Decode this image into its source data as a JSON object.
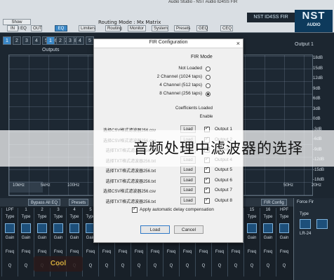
{
  "window": {
    "title": "Audio Studio - NST Audio ID4SS FIR",
    "brand": "NST ID4SS FIR",
    "logo_big": "NST",
    "logo_small": "AUDIO"
  },
  "toolbar": {
    "row1_label": "Routing Mode : Mx Matrix",
    "show_global_eq": "Show Global EQ",
    "buttons": [
      "IN",
      "OUT",
      "EQ",
      "Limiters",
      "Routing",
      "Monitor",
      "System",
      "Presets",
      "GEQ",
      "CEQ"
    ]
  },
  "channels": [
    "1",
    "2",
    "3",
    "4",
    "5",
    "6",
    "7",
    "8"
  ],
  "channels_right": [
    "1",
    "2",
    "3",
    "4",
    "5"
  ],
  "graph": {
    "outputs_label": "Outputs",
    "output1_label": "Output 1",
    "y_ticks": [
      "18dB",
      "15dB",
      "12dB",
      "9dB",
      "6dB",
      "3dB",
      "0dB",
      "-3dB",
      "-6dB",
      "-9dB",
      "-12dB",
      "-15dB",
      "-18dB"
    ],
    "x_ticks": [
      "10kHz",
      "5kHz",
      "100Hz",
      "50Hz",
      "20Hz"
    ]
  },
  "bottom": {
    "tabs": [
      "Bypass All EQ",
      "Presets",
      "FIR Config",
      "Force Fir"
    ],
    "strip_labels": [
      "LPF",
      "1",
      "2",
      "3",
      "4",
      "5",
      "6",
      "7",
      "8",
      "9",
      "10",
      "11",
      "12",
      "13",
      "14",
      "15",
      "16",
      "HPF"
    ],
    "strip_type": "Type",
    "strip_freq": "Freq",
    "strip_q": "Q",
    "strip_gain": "Gain",
    "right_type": "Type",
    "right_value": "LR-24",
    "watermark": "Cool"
  },
  "dialog": {
    "title": "FIR Configuration",
    "close": "×",
    "fir_mode_title": "FIR Mode",
    "modes": [
      {
        "label": "Not Loaded",
        "selected": false
      },
      {
        "label": "2 Channel (1024 taps)",
        "selected": false
      },
      {
        "label": "4 Channel (512 taps)",
        "selected": false
      },
      {
        "label": "8 Channel (256 taps)",
        "selected": true
      }
    ],
    "col_coeff": "Coefficients Loaded",
    "col_enable": "Enable",
    "outputs": [
      {
        "file": "选择CSV格式滤波器256.csv",
        "load": "Load",
        "enabled": true,
        "name": "Output 1"
      },
      {
        "file": "选择CSV格式滤波器256.csv",
        "load": "Load",
        "enabled": true,
        "name": "Output 2"
      },
      {
        "file": "选择TXT格式滤波器256.txt",
        "load": "Load",
        "enabled": true,
        "name": "Output 3"
      },
      {
        "file": "选择TXT格式滤波器256.txt",
        "load": "Load",
        "enabled": true,
        "name": "Output 4"
      },
      {
        "file": "选择TXT格式滤波器256.txt",
        "load": "Load",
        "enabled": true,
        "name": "Output 5"
      },
      {
        "file": "选择TXT格式滤波器256.txt",
        "load": "Load",
        "enabled": true,
        "name": "Output 6"
      },
      {
        "file": "选择CSV格式滤波器256.csv",
        "load": "Load",
        "enabled": true,
        "name": "Output 7"
      },
      {
        "file": "选择TXT格式滤波器256.txt",
        "load": "Load",
        "enabled": true,
        "name": "Output 8"
      }
    ],
    "apply_label": "Apply automatic delay compensation",
    "apply_checked": true,
    "buttons": {
      "load": "Load",
      "cancel": "Cancel"
    }
  },
  "overlay": {
    "caption": "音频处理中滤波器的选择"
  }
}
